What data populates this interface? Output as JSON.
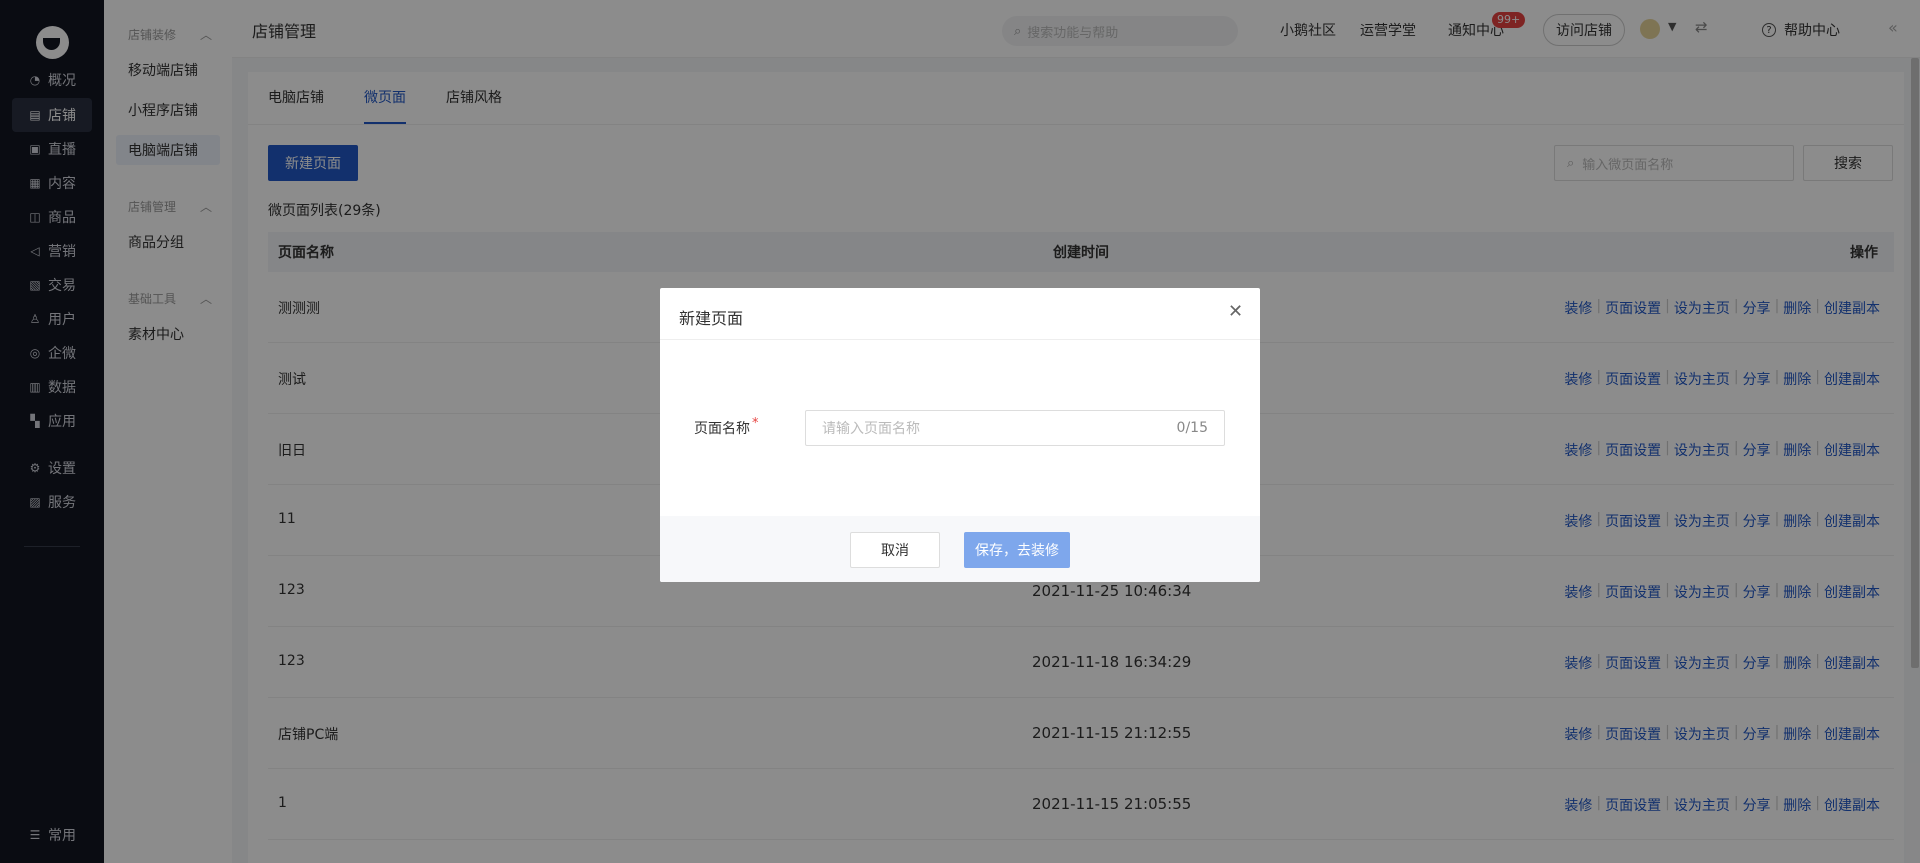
{
  "nav": {
    "items": [
      {
        "label": "概况",
        "icon": "chart-pie-icon"
      },
      {
        "label": "店铺",
        "icon": "store-icon"
      },
      {
        "label": "直播",
        "icon": "live-icon"
      },
      {
        "label": "内容",
        "icon": "document-icon"
      },
      {
        "label": "商品",
        "icon": "bag-icon"
      },
      {
        "label": "营销",
        "icon": "megaphone-icon"
      },
      {
        "label": "交易",
        "icon": "trade-icon"
      },
      {
        "label": "用户",
        "icon": "user-icon"
      },
      {
        "label": "企微",
        "icon": "wechat-work-icon"
      },
      {
        "label": "数据",
        "icon": "data-icon"
      },
      {
        "label": "应用",
        "icon": "apps-icon"
      },
      {
        "label": "设置",
        "icon": "gear-icon"
      },
      {
        "label": "服务",
        "icon": "service-icon"
      }
    ],
    "bottom_label": "常用",
    "active_color": "#2a3141"
  },
  "subnav": {
    "groups": [
      {
        "title": "店铺装修",
        "links": [
          "移动端店铺",
          "小程序店铺",
          "电脑端店铺"
        ]
      },
      {
        "title": "店铺管理",
        "links": [
          "商品分组"
        ]
      },
      {
        "title": "基础工具",
        "links": [
          "素材中心"
        ]
      }
    ]
  },
  "header": {
    "title": "店铺管理",
    "search_placeholder": "搜索功能与帮助",
    "links": [
      "小鹅社区",
      "运营学堂",
      "通知中心"
    ],
    "badge": "99+",
    "visit_store": "访问店铺",
    "help": "帮助中心"
  },
  "tabs": [
    "电脑店铺",
    "微页面",
    "店铺风格"
  ],
  "toolbar": {
    "new_page": "新建页面",
    "search_placeholder": "输入微页面名称",
    "search_button": "搜索"
  },
  "list_title": "微页面列表(29条)",
  "table": {
    "headers": [
      "页面名称",
      "创建时间",
      "操作"
    ],
    "actions": [
      "装修",
      "页面设置",
      "设为主页",
      "分享",
      "删除",
      "创建副本"
    ],
    "rows": [
      {
        "name": "测测测",
        "time": ""
      },
      {
        "name": "测试",
        "time": ""
      },
      {
        "name": "旧日",
        "time": ""
      },
      {
        "name": "11",
        "time": ""
      },
      {
        "name": "123",
        "time": "2021-11-25 10:46:34"
      },
      {
        "name": "123",
        "time": "2021-11-18 16:34:29"
      },
      {
        "name": "店铺PC端",
        "time": "2021-11-15 21:12:55"
      },
      {
        "name": "1",
        "time": "2021-11-15 21:05:55"
      }
    ]
  },
  "modal": {
    "title": "新建页面",
    "field_label": "页面名称",
    "required_mark": "*",
    "input_placeholder": "请输入页面名称",
    "counter": "0/15",
    "cancel": "取消",
    "save": "保存，去装修"
  },
  "colors": {
    "primary": "#2158c7",
    "nav_bg": "#131722",
    "save_disabled": "#7ea7ec"
  }
}
